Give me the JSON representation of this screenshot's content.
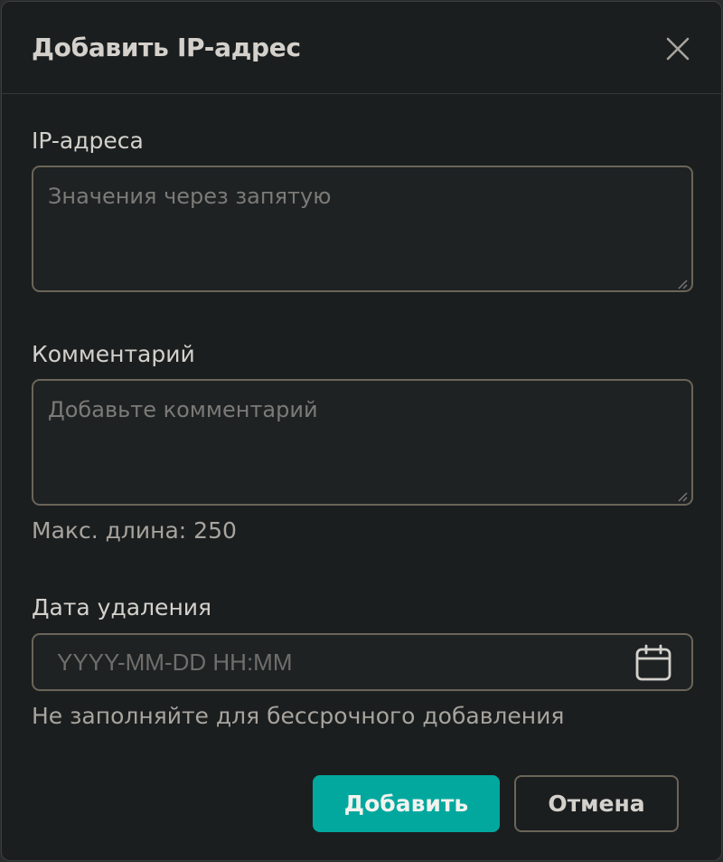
{
  "dialog": {
    "title": "Добавить IP-адрес"
  },
  "fields": {
    "ip": {
      "label": "IP-адреса",
      "value": "",
      "placeholder": "Значения через запятую"
    },
    "comment": {
      "label": "Комментарий",
      "value": "",
      "placeholder": "Добавьте комментарий",
      "hint": "Макс. длина: 250"
    },
    "date": {
      "label": "Дата удаления",
      "value": "",
      "placeholder": "YYYY-MM-DD HH:MM",
      "hint": "Не заполняйте для бессрочного добавления"
    }
  },
  "actions": {
    "submit_label": "Добавить",
    "cancel_label": "Отмена"
  },
  "icons": {
    "close": "close-icon",
    "calendar": "calendar-icon",
    "resize": "resize-grip-icon"
  },
  "colors": {
    "background": "#1b1e1f",
    "border": "#6b6558",
    "accent": "#02a89e",
    "text": "#d4d1cc",
    "muted": "#a8a49e"
  }
}
